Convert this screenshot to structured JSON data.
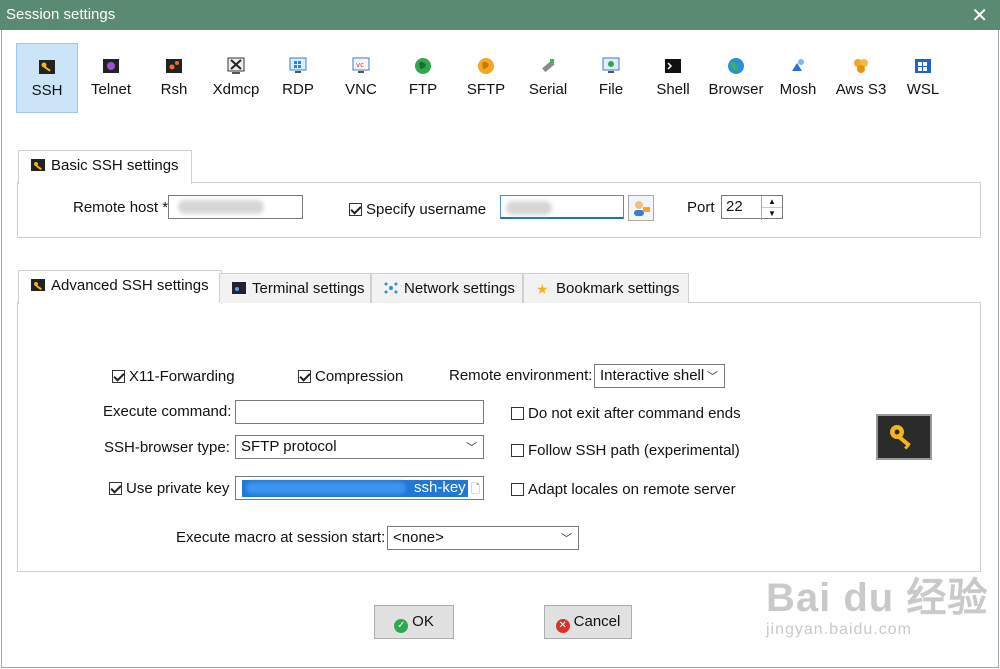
{
  "window": {
    "title": "Session settings",
    "close_glyph": "✕"
  },
  "session_types": [
    {
      "label": "SSH",
      "icon": "ssh-key-icon",
      "active": true
    },
    {
      "label": "Telnet",
      "icon": "telnet-icon"
    },
    {
      "label": "Rsh",
      "icon": "rsh-icon"
    },
    {
      "label": "Xdmcp",
      "icon": "xdmcp-icon"
    },
    {
      "label": "RDP",
      "icon": "rdp-icon"
    },
    {
      "label": "VNC",
      "icon": "vnc-icon"
    },
    {
      "label": "FTP",
      "icon": "ftp-icon"
    },
    {
      "label": "SFTP",
      "icon": "sftp-icon"
    },
    {
      "label": "Serial",
      "icon": "serial-icon"
    },
    {
      "label": "File",
      "icon": "file-icon"
    },
    {
      "label": "Shell",
      "icon": "shell-icon"
    },
    {
      "label": "Browser",
      "icon": "browser-icon"
    },
    {
      "label": "Mosh",
      "icon": "mosh-icon"
    },
    {
      "label": "Aws S3",
      "icon": "aws-s3-icon"
    },
    {
      "label": "WSL",
      "icon": "wsl-icon"
    }
  ],
  "basic": {
    "tab_label": "Basic SSH settings",
    "remote_host_label": "Remote host *",
    "remote_host_value": "",
    "specify_username_label": "Specify username",
    "specify_username_checked": true,
    "username_value": "",
    "port_label": "Port",
    "port_value": "22"
  },
  "tabs": [
    {
      "label": "Advanced SSH settings",
      "active": true
    },
    {
      "label": "Terminal settings"
    },
    {
      "label": "Network settings"
    },
    {
      "label": "Bookmark settings"
    }
  ],
  "advanced": {
    "x11_label": "X11-Forwarding",
    "x11_checked": true,
    "compression_label": "Compression",
    "compression_checked": true,
    "remote_env_label": "Remote environment:",
    "remote_env_value": "Interactive shell",
    "execute_command_label": "Execute command:",
    "execute_command_value": "",
    "do_not_exit_label": "Do not exit after command ends",
    "browser_type_label": "SSH-browser type:",
    "browser_type_value": "SFTP protocol",
    "follow_path_label": "Follow SSH path (experimental)",
    "use_private_key_label": "Use private key",
    "use_private_key_checked": true,
    "private_key_value": "ssh-key",
    "adapt_locales_label": "Adapt locales on remote server",
    "macro_label": "Execute macro at session start:",
    "macro_value": "<none>"
  },
  "buttons": {
    "ok": "OK",
    "cancel": "Cancel"
  },
  "watermark": {
    "line1": "Bai du 经验",
    "line2": "jingyan.baidu.com"
  },
  "colors": {
    "titlebar": "#5b8a72",
    "active_tab": "#cce4f7",
    "ok_icon": "#2fa84f",
    "cancel_icon": "#d9342b",
    "key_gold": "#f2b51c"
  }
}
